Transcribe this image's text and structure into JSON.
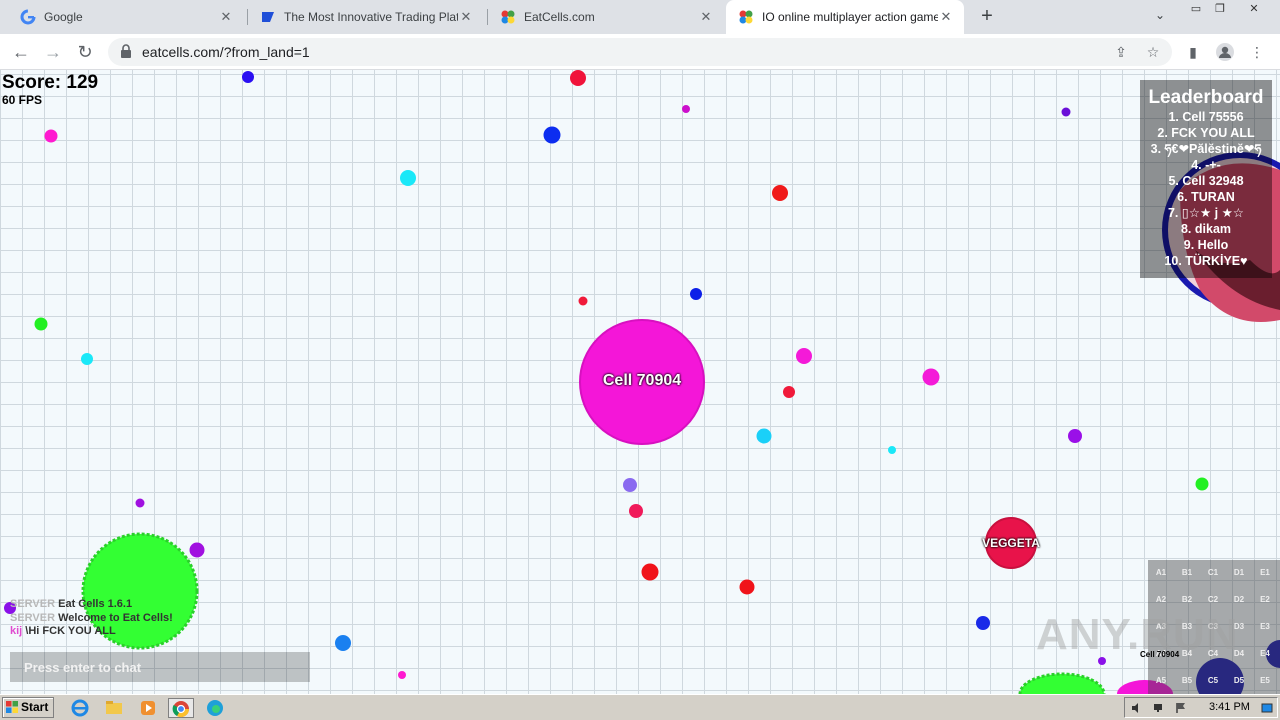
{
  "browser": {
    "tabs": [
      {
        "title": "Google",
        "favicon": "google-icon",
        "active": false
      },
      {
        "title": "The Most Innovative Trading Platfor",
        "favicon": "trading-icon",
        "active": false
      },
      {
        "title": "EatCells.com",
        "favicon": "eatcells-icon",
        "active": false
      },
      {
        "title": "IO online multiplayer action game. S",
        "favicon": "eatcells-icon",
        "active": true
      }
    ],
    "url": "eatcells.com/?from_land=1"
  },
  "game": {
    "score": "Score: 129",
    "fps": "60 FPS",
    "player_cell": "Cell 70904",
    "enemy_cell": "VEGGETA",
    "leaderboard": {
      "title": "Leaderboard",
      "rows": [
        "1. Cell 75556",
        "2. FCK YOU ALL",
        "3. ཧ€❤Pălĕstinĕ❤ཧ",
        "4. -+-",
        "5. Cell 32948",
        "6. TURAN",
        "7. ▯☆★ j ★☆",
        "8. dikam",
        "9. Hello",
        "10. TÜRKİYE♥"
      ]
    },
    "chat": [
      {
        "sender": "SERVER",
        "message": "Eat Cells 1.6.1"
      },
      {
        "sender": "SERVER",
        "message": "Welcome to Eat Cells!"
      },
      {
        "sender": "kij",
        "message": "\\Hi FCK YOU ALL"
      }
    ],
    "chat_placeholder": "Press enter to chat",
    "minimap": {
      "rows": [
        [
          "A1",
          "B1",
          "C1",
          "D1",
          "E1"
        ],
        [
          "A2",
          "B2",
          "C2",
          "D2",
          "E2"
        ],
        [
          "A3",
          "B3",
          "C3",
          "D3",
          "E3"
        ],
        [
          "A4",
          "B4",
          "C4",
          "D4",
          "E4"
        ],
        [
          "A5",
          "B5",
          "C5",
          "D5",
          "E5"
        ]
      ],
      "player_label": "Cell 70904"
    },
    "watermark": "ANY.RUN",
    "colors": {
      "player": "#f416d8",
      "enemy": "#e8134a",
      "green_cell": "#33ff33"
    }
  },
  "taskbar": {
    "start_label": "Start",
    "clock": "3:41 PM"
  }
}
